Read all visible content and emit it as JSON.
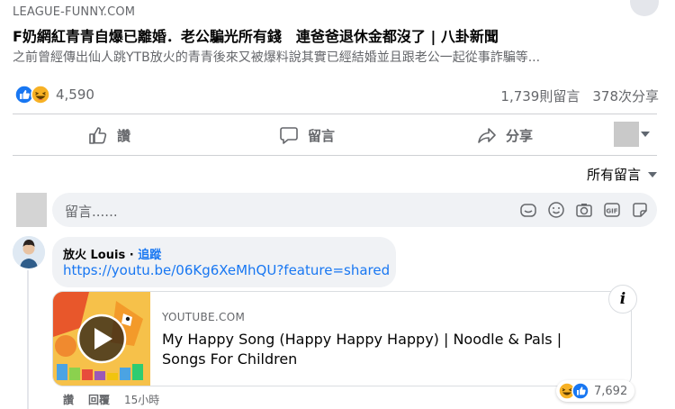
{
  "post": {
    "source": "LEAGUE-FUNNY.COM",
    "headline": "F奶網紅青青自爆已離婚．老公騙光所有錢　連爸爸退休金都沒了 | 八卦新聞",
    "description": "之前曾經傳出仙人跳YTB放火的青青後來又被爆料說其實已經結婚並且跟老公一起從事詐騙等..."
  },
  "reactions": {
    "count": "4,590",
    "comments": "1,739則留言",
    "shares": "378次分享"
  },
  "actions": {
    "like": "讚",
    "comment": "留言",
    "share": "分享"
  },
  "sort": {
    "label": "所有留言"
  },
  "composer": {
    "placeholder": "留言......"
  },
  "comment": {
    "author": "放火 Louis",
    "separator": " · ",
    "follow": "追蹤",
    "link": "https://youtu.be/06Kg6XeMhQU?feature=shared",
    "card": {
      "domain": "YOUTUBE.COM",
      "title": "My Happy Song (Happy Happy Happy) | Noodle & Pals | Songs For Children",
      "info": "i"
    },
    "like": "讚",
    "reply": "回覆",
    "time": "15小時",
    "reaction_count": "7,692"
  },
  "colors": {
    "link": "#1877f2",
    "secondary_text": "#65676b",
    "haha": "#f7b125"
  }
}
